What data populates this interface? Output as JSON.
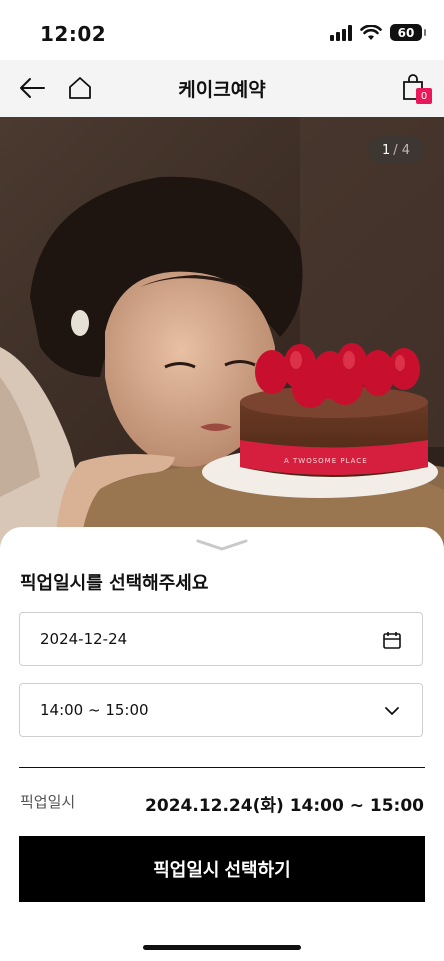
{
  "status_bar": {
    "time": "12:02",
    "battery": "60"
  },
  "header": {
    "title": "케이크예약",
    "cart_count": "0"
  },
  "carousel": {
    "current": "1",
    "separator": "/",
    "total": "4"
  },
  "hero_image": {
    "cake_band_text": "A TWOSOME PLACE"
  },
  "sheet": {
    "title": "픽업일시를 선택해주세요",
    "date_value": "2024-12-24",
    "time_value": "14:00 ~ 15:00",
    "summary_label": "픽업일시",
    "summary_value": "2024.12.24(화) 14:00 ~ 15:00",
    "confirm_label": "픽업일시 선택하기"
  },
  "icons": {
    "back": "arrow-left-icon",
    "home": "home-icon",
    "cart": "shopping-bag-icon",
    "date": "calendar-icon",
    "time": "chevron-down-icon"
  },
  "colors": {
    "badge": "#e8185a",
    "button": "#000000",
    "header_bg": "#f4f4f4"
  }
}
